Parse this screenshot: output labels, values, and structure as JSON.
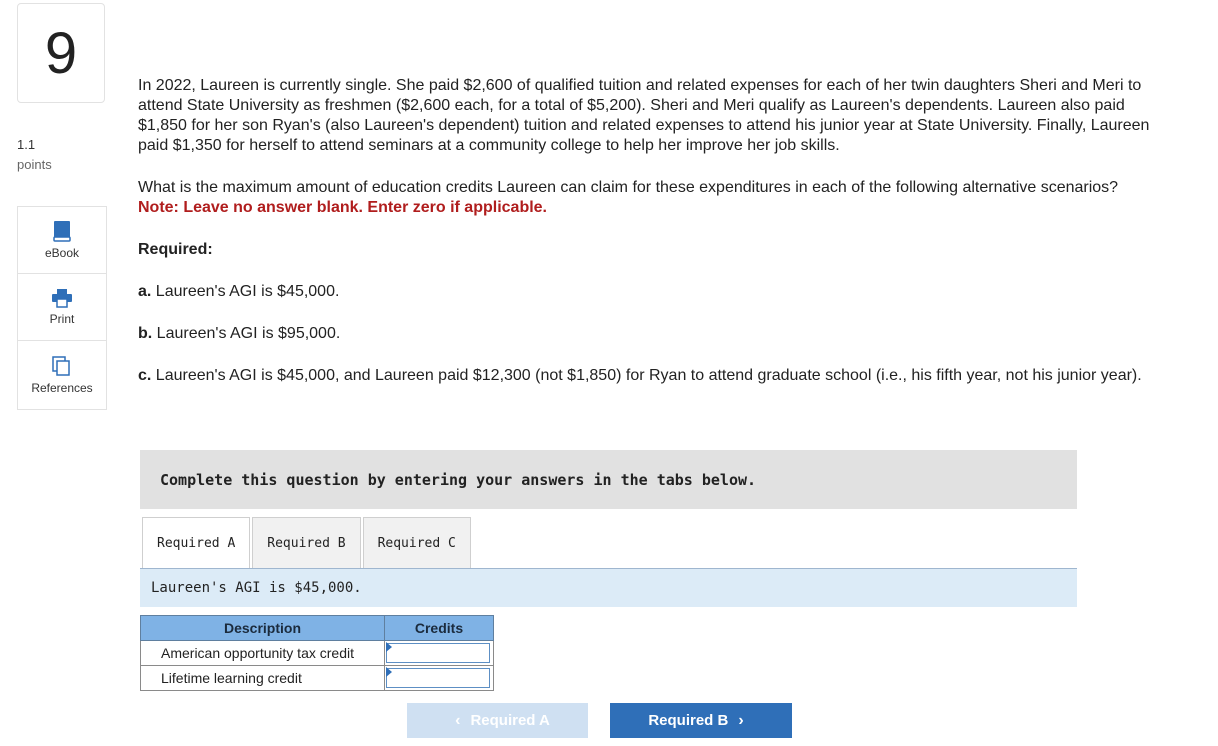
{
  "question": {
    "number": "9",
    "points_value": "1.1",
    "points_label": "points"
  },
  "tools": [
    {
      "label": "eBook",
      "icon": "book-icon"
    },
    {
      "label": "Print",
      "icon": "printer-icon"
    },
    {
      "label": "References",
      "icon": "references-icon"
    }
  ],
  "prompt": {
    "paragraph1": "In 2022, Laureen is currently single. She paid $2,600 of qualified tuition and related expenses for each of her twin daughters Sheri and Meri to attend State University as freshmen ($2,600 each, for a total of $5,200). Sheri and Meri qualify as Laureen's dependents. Laureen also paid $1,850 for her son Ryan's (also Laureen's dependent) tuition and related expenses to attend his junior year at State University. Finally, Laureen paid $1,350 for herself to attend seminars at a community college to help her improve her job skills.",
    "paragraph2": "What is the maximum amount of education credits Laureen can claim for these expenditures in each of the following alternative scenarios?",
    "note": "Note: Leave no answer blank. Enter zero if applicable.",
    "required_heading": "Required:",
    "items": [
      {
        "letter": "a.",
        "text": "Laureen's AGI is $45,000."
      },
      {
        "letter": "b.",
        "text": "Laureen's AGI is $95,000."
      },
      {
        "letter": "c.",
        "text": "Laureen's AGI is $45,000, and Laureen paid $12,300 (not $1,850) for Ryan to attend graduate school (i.e., his fifth year, not his junior year)."
      }
    ]
  },
  "instructions": "Complete this question by entering your answers in the tabs below.",
  "tabs": [
    {
      "label": "Required A",
      "active": true
    },
    {
      "label": "Required B",
      "active": false
    },
    {
      "label": "Required C",
      "active": false
    }
  ],
  "tab_content": {
    "header": "Laureen's AGI is $45,000.",
    "table": {
      "columns": [
        "Description",
        "Credits"
      ],
      "rows": [
        {
          "description": "American opportunity tax credit",
          "credits": ""
        },
        {
          "description": "Lifetime learning credit",
          "credits": ""
        }
      ]
    }
  },
  "navigation": {
    "prev_label": "Required A",
    "next_label": "Required B",
    "prev_chevron": "‹",
    "next_chevron": "›"
  },
  "colors": {
    "accent": "#2f6fb8",
    "note": "#b01d1d",
    "table_header": "#7fb2e5",
    "tab_content_bg": "#dcebf7"
  }
}
